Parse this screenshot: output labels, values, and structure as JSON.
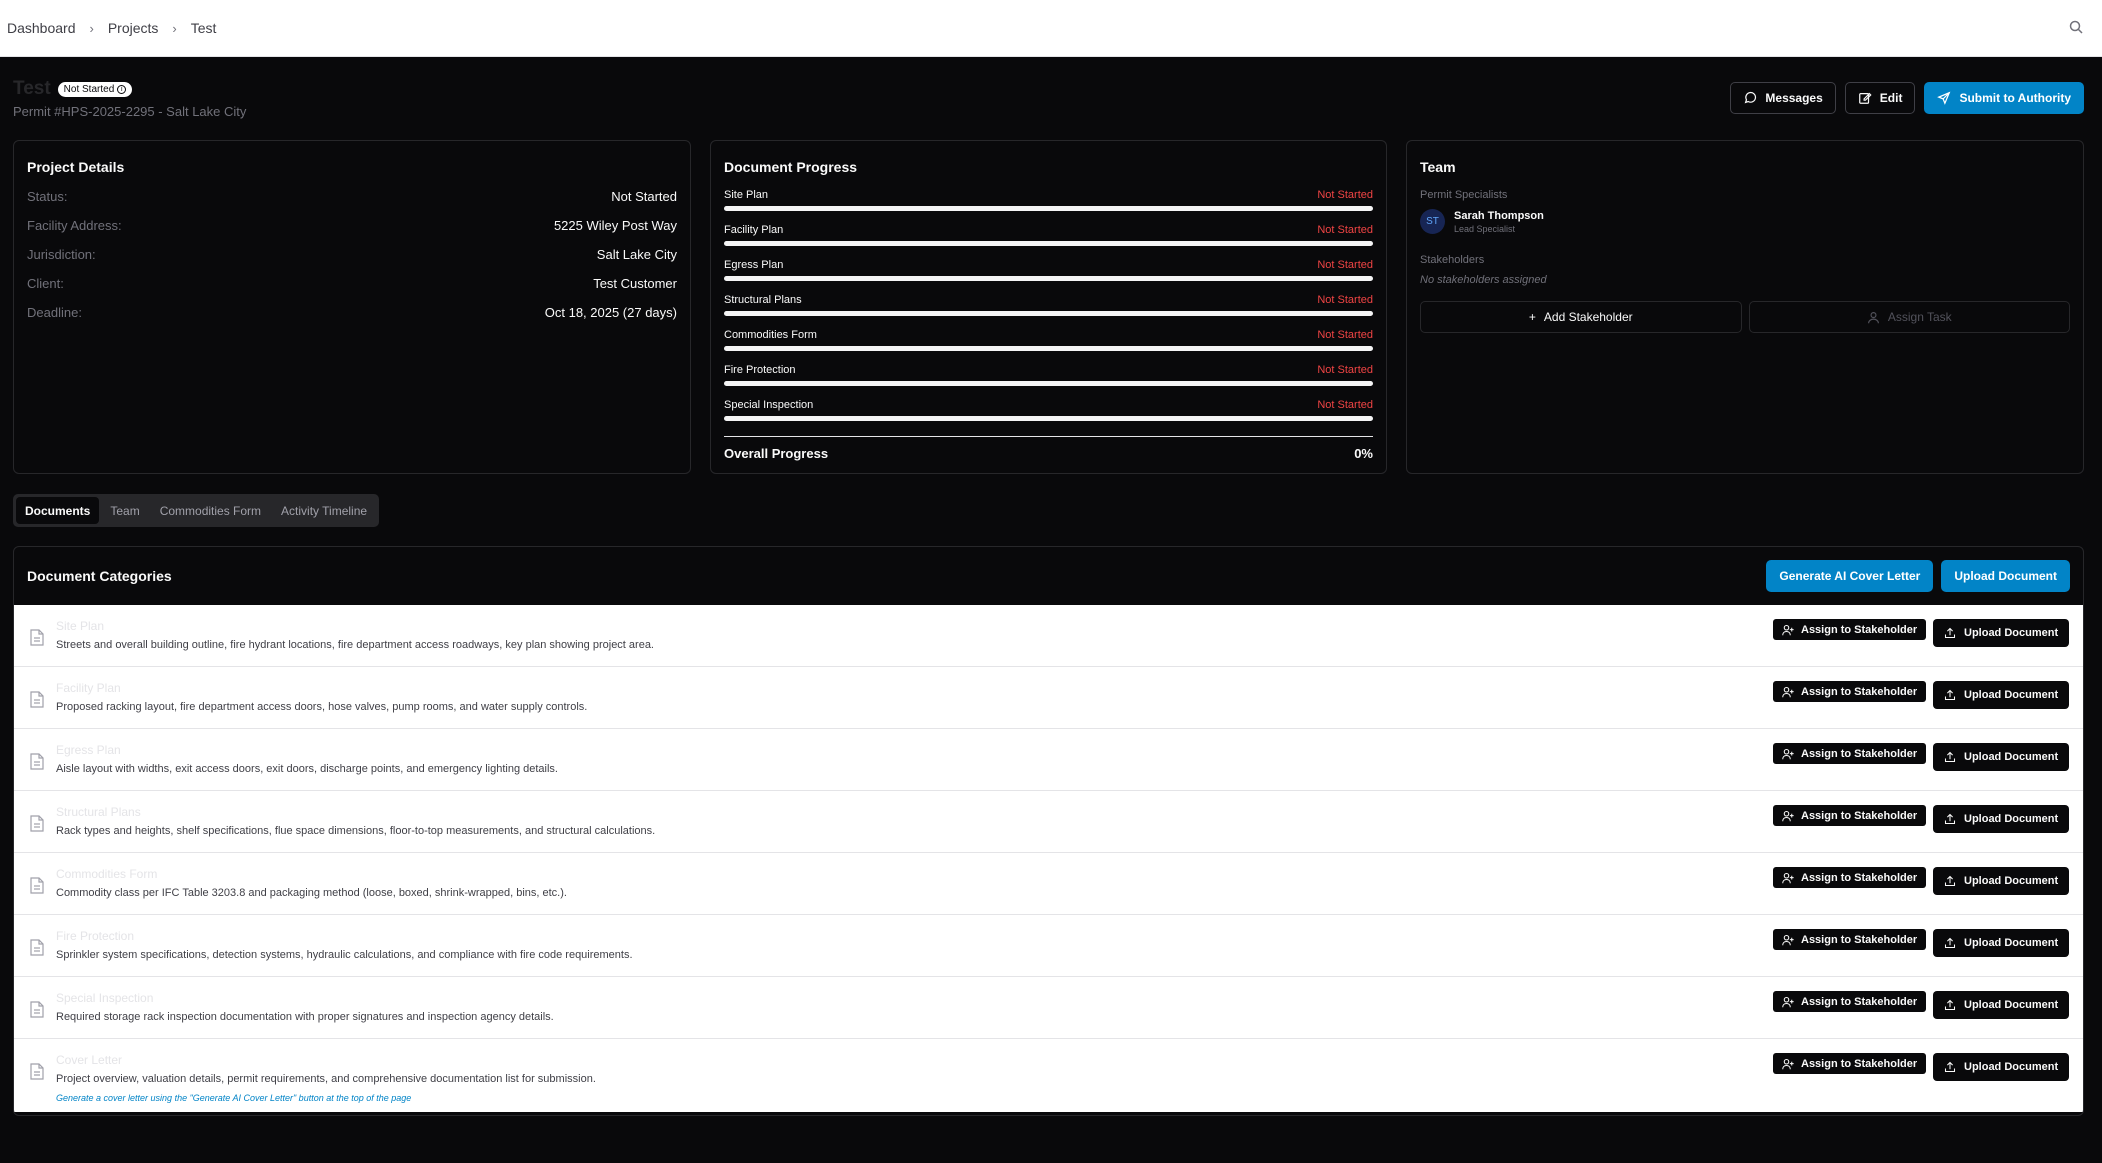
{
  "breadcrumb": [
    "Dashboard",
    "Projects",
    "Test"
  ],
  "header": {
    "title": "Test",
    "status_badge": "Not Started",
    "permit": "Permit #HPS-2025-2295 - Salt Lake City",
    "messages_label": "Messages",
    "edit_label": "Edit",
    "submit_label": "Submit to Authority"
  },
  "project_details": {
    "title": "Project Details",
    "rows": [
      {
        "label": "Status:",
        "value": "Not Started"
      },
      {
        "label": "Facility Address:",
        "value": "5225 Wiley Post Way"
      },
      {
        "label": "Jurisdiction:",
        "value": "Salt Lake City"
      },
      {
        "label": "Client:",
        "value": "Test Customer"
      },
      {
        "label": "Deadline:",
        "value": "Oct 18, 2025 (27 days)"
      }
    ]
  },
  "document_progress": {
    "title": "Document Progress",
    "items": [
      {
        "name": "Site Plan",
        "status": "Not Started",
        "progress": 0
      },
      {
        "name": "Facility Plan",
        "status": "Not Started",
        "progress": 0
      },
      {
        "name": "Egress Plan",
        "status": "Not Started",
        "progress": 0
      },
      {
        "name": "Structural Plans",
        "status": "Not Started",
        "progress": 0
      },
      {
        "name": "Commodities Form",
        "status": "Not Started",
        "progress": 0
      },
      {
        "name": "Fire Protection",
        "status": "Not Started",
        "progress": 0
      },
      {
        "name": "Special Inspection",
        "status": "Not Started",
        "progress": 0
      }
    ],
    "overall_label": "Overall Progress",
    "overall_value": "0%"
  },
  "team": {
    "title": "Team",
    "specialists_label": "Permit Specialists",
    "member": {
      "initials": "ST",
      "name": "Sarah Thompson",
      "role": "Lead Specialist"
    },
    "stakeholders_label": "Stakeholders",
    "no_stakeholders": "No stakeholders assigned",
    "add_stakeholder": "Add Stakeholder",
    "assign_task": "Assign Task"
  },
  "tabs": [
    "Documents",
    "Team",
    "Commodities Form",
    "Activity Timeline"
  ],
  "doc_categories": {
    "title": "Document Categories",
    "generate_label": "Generate AI Cover Letter",
    "upload_label": "Upload Document",
    "assign_label": "Assign to Stakeholder",
    "rows": [
      {
        "title": "Site Plan",
        "desc": "Streets and overall building outline, fire hydrant locations, fire department access roadways, key plan showing project area."
      },
      {
        "title": "Facility Plan",
        "desc": "Proposed racking layout, fire department access doors, hose valves, pump rooms, and water supply controls."
      },
      {
        "title": "Egress Plan",
        "desc": "Aisle layout with widths, exit access doors, exit doors, discharge points, and emergency lighting details."
      },
      {
        "title": "Structural Plans",
        "desc": "Rack types and heights, shelf specifications, flue space dimensions, floor-to-top measurements, and structural calculations."
      },
      {
        "title": "Commodities Form",
        "desc": "Commodity class per IFC Table 3203.8 and packaging method (loose, boxed, shrink-wrapped, bins, etc.)."
      },
      {
        "title": "Fire Protection",
        "desc": "Sprinkler system specifications, detection systems, hydraulic calculations, and compliance with fire code requirements."
      },
      {
        "title": "Special Inspection",
        "desc": "Required storage rack inspection documentation with proper signatures and inspection agency details."
      },
      {
        "title": "Cover Letter",
        "desc": "Project overview, valuation details, permit requirements, and comprehensive documentation list for submission.",
        "note": "Generate a cover letter using the \"Generate AI Cover Letter\" button at the top of the page"
      }
    ]
  }
}
